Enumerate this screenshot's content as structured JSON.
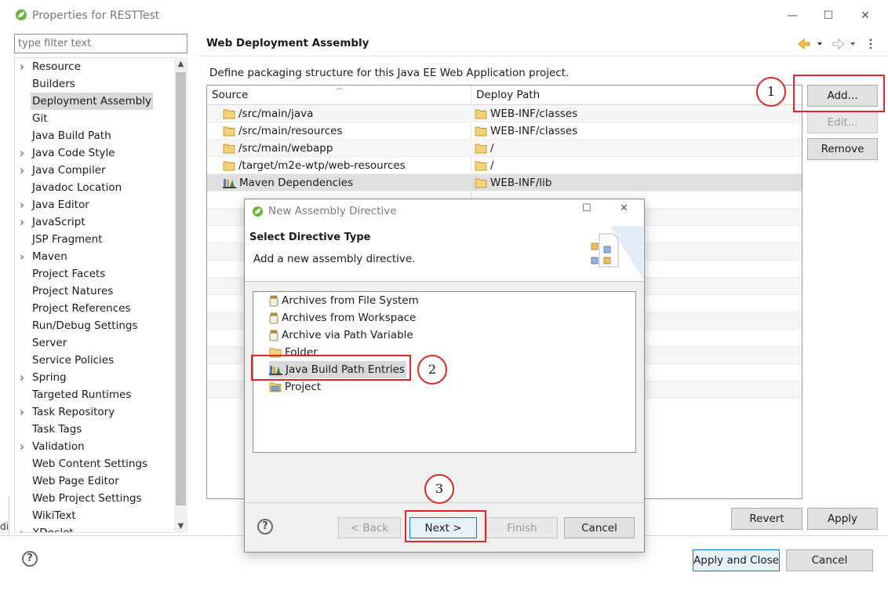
{
  "window": {
    "title": "Properties for RESTTest",
    "minimize_glyph": "—",
    "maximize_glyph": "☐",
    "close_glyph": "✕"
  },
  "sidebar": {
    "filter_placeholder": "type filter text",
    "selected": "Deployment Assembly",
    "items": [
      {
        "label": "Resource",
        "expandable": true
      },
      {
        "label": "Builders",
        "expandable": false
      },
      {
        "label": "Deployment Assembly",
        "expandable": false
      },
      {
        "label": "Git",
        "expandable": false
      },
      {
        "label": "Java Build Path",
        "expandable": false
      },
      {
        "label": "Java Code Style",
        "expandable": true
      },
      {
        "label": "Java Compiler",
        "expandable": true
      },
      {
        "label": "Javadoc Location",
        "expandable": false
      },
      {
        "label": "Java Editor",
        "expandable": true
      },
      {
        "label": "JavaScript",
        "expandable": true
      },
      {
        "label": "JSP Fragment",
        "expandable": false
      },
      {
        "label": "Maven",
        "expandable": true
      },
      {
        "label": "Project Facets",
        "expandable": false
      },
      {
        "label": "Project Natures",
        "expandable": false
      },
      {
        "label": "Project References",
        "expandable": false
      },
      {
        "label": "Run/Debug Settings",
        "expandable": false
      },
      {
        "label": "Server",
        "expandable": false
      },
      {
        "label": "Service Policies",
        "expandable": false
      },
      {
        "label": "Spring",
        "expandable": true
      },
      {
        "label": "Targeted Runtimes",
        "expandable": false
      },
      {
        "label": "Task Repository",
        "expandable": true
      },
      {
        "label": "Task Tags",
        "expandable": false
      },
      {
        "label": "Validation",
        "expandable": true
      },
      {
        "label": "Web Content Settings",
        "expandable": false
      },
      {
        "label": "Web Page Editor",
        "expandable": false
      },
      {
        "label": "Web Project Settings",
        "expandable": false
      },
      {
        "label": "WikiText",
        "expandable": false
      },
      {
        "label": "XDoclet",
        "expandable": true
      }
    ]
  },
  "page": {
    "title": "Web Deployment Assembly",
    "description": "Define packaging structure for this Java EE Web Application project.",
    "table": {
      "columns": [
        "Source",
        "Deploy Path"
      ],
      "rows": [
        {
          "source": "/src/main/java",
          "source_icon": "folder-icon",
          "deploy": "WEB-INF/classes"
        },
        {
          "source": "/src/main/resources",
          "source_icon": "folder-icon",
          "deploy": "WEB-INF/classes"
        },
        {
          "source": "/src/main/webapp",
          "source_icon": "folder-icon",
          "deploy": "/"
        },
        {
          "source": "/target/m2e-wtp/web-resources",
          "source_icon": "folder-icon",
          "deploy": "/"
        },
        {
          "source": "Maven Dependencies",
          "source_icon": "library-icon",
          "deploy": "WEB-INF/lib"
        }
      ]
    },
    "buttons": {
      "add": "Add...",
      "edit": "Edit...",
      "remove": "Remove",
      "revert": "Revert",
      "apply": "Apply"
    }
  },
  "footer": {
    "help": "?",
    "apply_close": "Apply and Close",
    "cancel": "Cancel",
    "left_clip": "di"
  },
  "dialog": {
    "title": "New Assembly Directive",
    "heading": "Select Directive Type",
    "subheading": "Add a new assembly directive.",
    "options": [
      {
        "label": "Archives from File System",
        "icon": "jar-icon"
      },
      {
        "label": "Archives from Workspace",
        "icon": "jar-icon"
      },
      {
        "label": "Archive via Path Variable",
        "icon": "jar-icon"
      },
      {
        "label": "Folder",
        "icon": "folder-icon"
      },
      {
        "label": "Java Build Path Entries",
        "icon": "library-icon"
      },
      {
        "label": "Project",
        "icon": "project-icon"
      }
    ],
    "selected": "Java Build Path Entries",
    "buttons": {
      "help": "?",
      "back": "< Back",
      "next": "Next >",
      "finish": "Finish",
      "cancel": "Cancel"
    }
  },
  "annotations": {
    "step1": "1",
    "step2": "2",
    "step3": "3"
  },
  "colors": {
    "highlight_red": "#e0262a",
    "default_button_border": "#0078d7",
    "selection_gray": "#d9d9d9"
  }
}
